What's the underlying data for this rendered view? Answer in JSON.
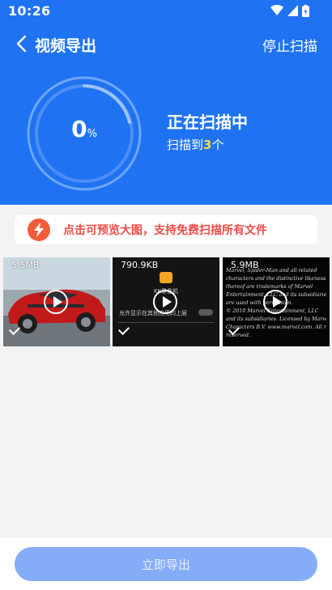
{
  "status_bar": {
    "time": "10:26"
  },
  "nav": {
    "title": "视频导出",
    "stop_label": "停止扫描"
  },
  "progress": {
    "percent": 0,
    "number": "0",
    "unit": "%"
  },
  "scan": {
    "status": "正在扫描中",
    "found_prefix": "扫描到",
    "found_count": "3",
    "found_suffix": "个"
  },
  "tip": {
    "text": "点击可预览大图，支持免费扫描所有文件"
  },
  "videos": [
    {
      "size": "5.5MB",
      "selected": true
    },
    {
      "size": "790.9KB",
      "selected": true,
      "preview_title": "KK录像机",
      "preview_line": "允许显示在其他应用的上层"
    },
    {
      "size": "5.9MB",
      "selected": true,
      "preview_text": [
        "Marvel, Spider-Man and all related",
        "characters and the distinctive likeness",
        "thereof are trademarks of Marvel",
        "Entertainment, LLC and its subsidiaries",
        "are used with permission.",
        "© 2010 Marvel Entertainment, LLC",
        "and its subsidiaries. Licensed by Marvel",
        "Characters B.V. www.marvel.com. All rights",
        "reserved."
      ]
    }
  ],
  "export_button": {
    "label": "立即导出"
  },
  "colors": {
    "primary": "#1f73f2",
    "tip_red": "#ef4b47",
    "highlight": "#ffd84a",
    "button_disabled": "#85acf6"
  }
}
